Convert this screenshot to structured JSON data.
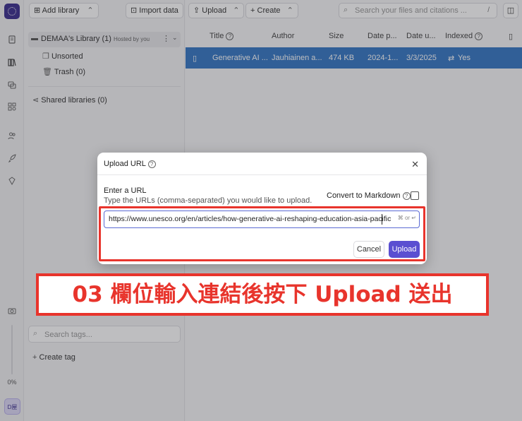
{
  "toolbar": {
    "add_library": "Add library",
    "import_data": "Import data",
    "upload": "Upload",
    "create": "Create",
    "search_placeholder": "Search your files and citations ...",
    "search_shortcut": "/"
  },
  "sidebar": {
    "library_name": "DEMAA's Library (1)",
    "library_hosted": "Hosted by you",
    "items": [
      {
        "label": "Unsorted"
      },
      {
        "label": "Trash (0)"
      }
    ],
    "shared_libraries": "Shared libraries (0)",
    "tag_search_placeholder": "Search tags...",
    "create_tag": "Create tag"
  },
  "rail": {
    "zoom": "0%",
    "avatar": "D屋"
  },
  "table": {
    "headers": [
      "Title",
      "Author",
      "Size",
      "Date p...",
      "Date u...",
      "Indexed"
    ],
    "rows": [
      {
        "title": "Generative AI ...",
        "author": "Jauhiainen a...",
        "size": "474 KB",
        "date_published": "2024-1...",
        "date_uploaded": "3/3/2025",
        "indexed": "Yes"
      }
    ]
  },
  "modal": {
    "title": "Upload URL",
    "enter_url_label": "Enter a URL",
    "hint": "Type the URLs (comma-separated) you would like to upload.",
    "convert_label": "Convert to Markdown",
    "url_value": "https://www.unesco.org/en/articles/how-generative-ai-reshaping-education-asia-pacific",
    "shortcut_or": "or",
    "cancel": "Cancel",
    "upload": "Upload"
  },
  "annotation": {
    "banner_text": "03 欄位輸入連結後按下 Upload 送出"
  },
  "colors": {
    "accent": "#5a4fd1",
    "selected_row": "#3677c4",
    "annotation_red": "#e8342c"
  }
}
